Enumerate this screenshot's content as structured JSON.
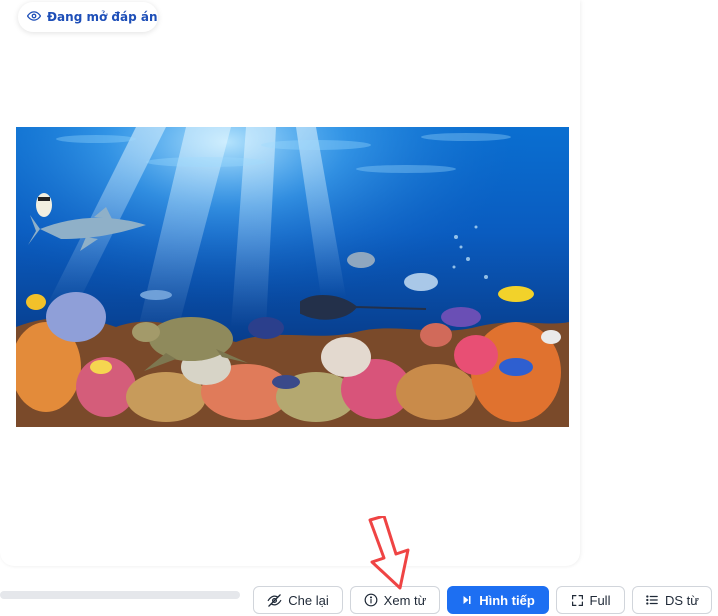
{
  "status": {
    "label": "Đang mở đáp án",
    "icon": "eye-icon"
  },
  "image": {
    "subject": "underwater-coral-reef-scene"
  },
  "progress": {
    "value": 0
  },
  "toolbar": {
    "hide_label": "Che lại",
    "view_word_label": "Xem từ",
    "next_image_label": "Hình tiếp",
    "full_label": "Full",
    "word_list_label": "DS từ"
  },
  "colors": {
    "primary": "#1d6ff2",
    "status_text": "#1e4fb8",
    "arrow": "#ef4444"
  }
}
